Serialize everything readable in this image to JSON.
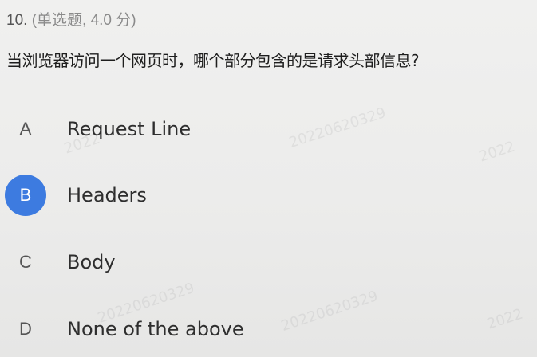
{
  "question": {
    "number": "10.",
    "meta": "(单选题, 4.0 分)",
    "stem": "当浏览器访问一个网页时，哪个部分包含的是请求头部信息?",
    "selected": "B"
  },
  "options": [
    {
      "letter": "A",
      "text": "Request  Line"
    },
    {
      "letter": "B",
      "text": "Headers"
    },
    {
      "letter": "C",
      "text": "Body"
    },
    {
      "letter": "D",
      "text": "None of the above"
    }
  ],
  "colors": {
    "selected": "#3d7be0"
  }
}
